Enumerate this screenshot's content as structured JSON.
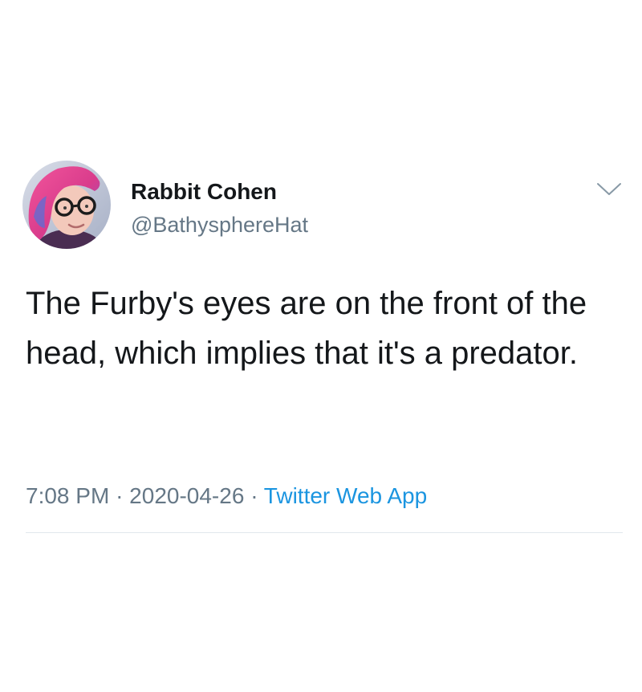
{
  "tweet": {
    "author": {
      "display_name": "Rabbit Cohen",
      "handle": "@BathysphereHat",
      "avatar_icon": "user-avatar"
    },
    "text": "The Furby's eyes are on the front of the head, which implies that it's a predator.",
    "time": "7:08 PM",
    "separator": "·",
    "date": "2020-04-26",
    "source": "Twitter Web App",
    "menu_icon": "chevron-down-icon"
  },
  "colors": {
    "text_primary": "#14171a",
    "text_secondary": "#657786",
    "link": "#1b95e0",
    "divider": "#e1e8ed"
  }
}
